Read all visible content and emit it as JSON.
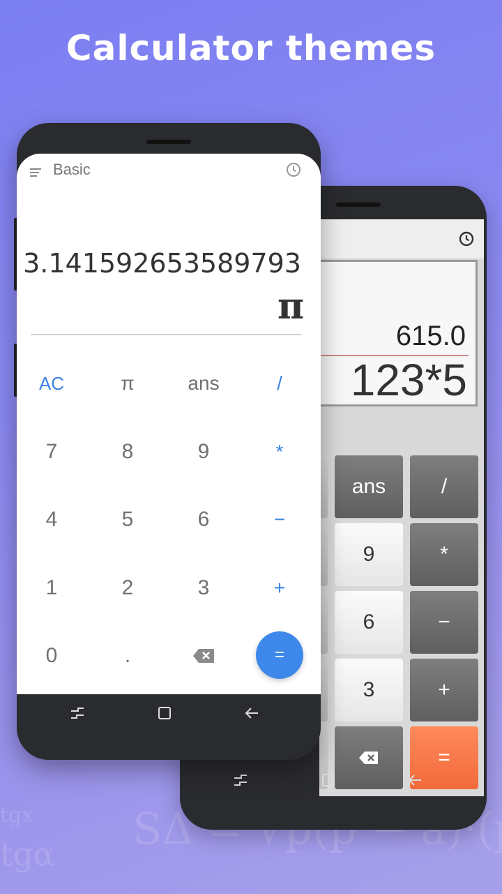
{
  "headline": "Calculator themes",
  "background_formulas": {
    "line1": "SΔ = √p(p − a)·(p",
    "line2": "tgα",
    "line3": "tgx"
  },
  "front_phone": {
    "mode_title": "Basic",
    "result": "3.141592653589793",
    "expression": "π",
    "keys": {
      "ac": "AC",
      "pi": "π",
      "ans": "ans",
      "divide": "/",
      "seven": "7",
      "eight": "8",
      "nine": "9",
      "multiply": "*",
      "four": "4",
      "five": "5",
      "six": "6",
      "minus": "−",
      "one": "1",
      "two": "2",
      "three": "3",
      "plus": "+",
      "zero": "0",
      "decimal": ".",
      "equals": "="
    },
    "colors": {
      "accent": "#3b82e6",
      "equals_bg": "#3d88ea"
    }
  },
  "back_phone": {
    "result": "615.0",
    "expression": "123*5",
    "keys": {
      "ans": "ans",
      "divide": "/",
      "nine": "9",
      "multiply": "*",
      "six": "6",
      "minus": "−",
      "three": "3",
      "plus": "+",
      "equals": "="
    },
    "colors": {
      "equals_bg": "#f26a3a",
      "operator_bg": "#6e6e6e"
    }
  }
}
